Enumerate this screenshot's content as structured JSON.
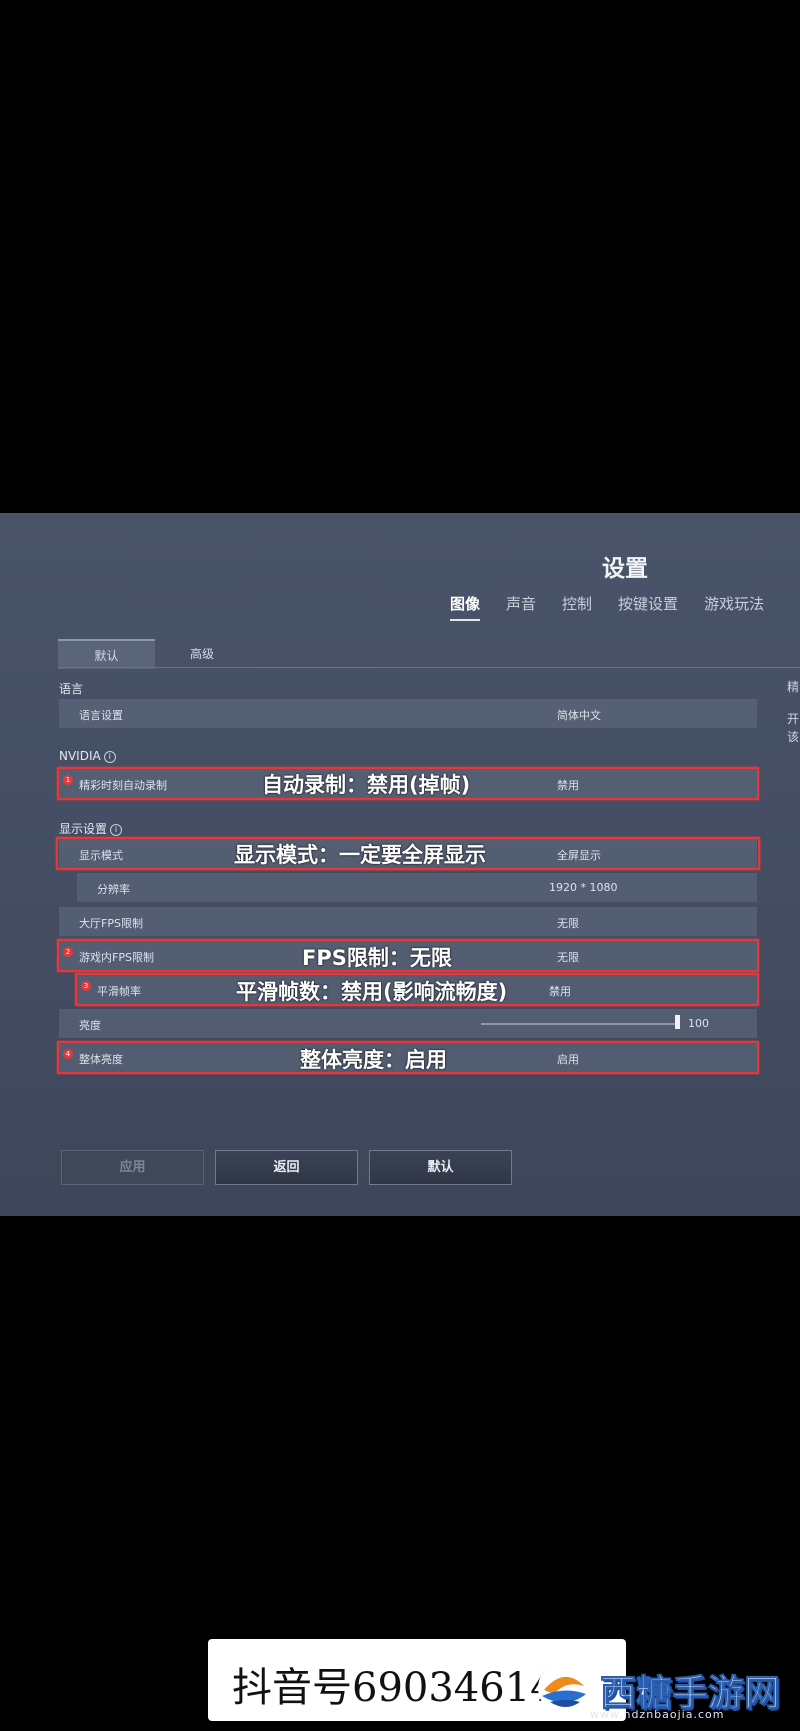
{
  "settings": {
    "title": "设置",
    "top_tabs": [
      "图像",
      "声音",
      "控制",
      "按键设置",
      "游戏玩法"
    ],
    "sub_tabs": [
      "默认",
      "高级"
    ],
    "sections": {
      "language": "语言",
      "nvidia": "NVIDIA",
      "display": "显示设置"
    },
    "info_glyph": "i",
    "rows": {
      "language_setting": {
        "label": "语言设置",
        "value": "简体中文"
      },
      "highlight_capture": {
        "label": "精彩时刻自动录制",
        "value": "禁用"
      },
      "display_mode": {
        "label": "显示模式",
        "value": "全屏显示"
      },
      "resolution": {
        "label": "分辨率",
        "value": "1920 * 1080"
      },
      "lobby_fps": {
        "label": "大厅FPS限制",
        "value": "无限"
      },
      "ingame_fps": {
        "label": "游戏内FPS限制",
        "value": "无限"
      },
      "smooth_frame": {
        "label": "平滑帧率",
        "value": "禁用"
      },
      "brightness": {
        "label": "亮度",
        "value": "100",
        "slider_level": 1.0
      },
      "overall_brightness": {
        "label": "整体亮度",
        "value": "启用"
      }
    },
    "right_panel": [
      "精",
      "开",
      "该"
    ],
    "buttons": {
      "apply": "应用",
      "back": "返回",
      "default": "默认"
    }
  },
  "annotations": {
    "a1": "自动录制：禁用(掉帧)",
    "a2": "显示模式：一定要全屏显示",
    "a3": "FPS限制：无限",
    "a4": "平滑帧数：禁用(影响流畅度)",
    "a5": "整体亮度：启用",
    "badges": [
      "1",
      "2",
      "3",
      "4"
    ]
  },
  "watermark": {
    "douyin_text": "抖音号69034614",
    "brand_text": "西糖手游网",
    "brand_url": "www.hdznbaojia.com"
  },
  "colors": {
    "highlight": "#e5383b",
    "panel": "#4a5469",
    "brand_blue": "#2a5fb0"
  }
}
